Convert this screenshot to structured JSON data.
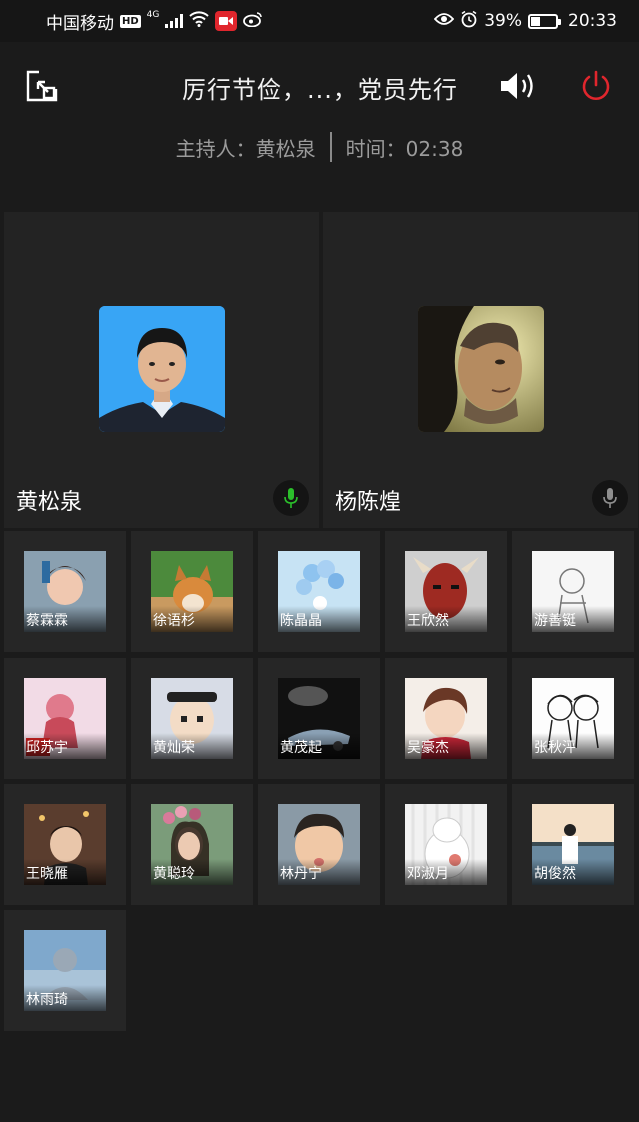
{
  "status_bar": {
    "carrier": "中国移动",
    "hd": "HD",
    "network": "4G",
    "battery_text": "39%",
    "battery_level": 0.39,
    "time": "20:33"
  },
  "header": {
    "title": "厉行节俭，...，党员先行",
    "host_label": "主持人：黄松泉",
    "time_label": "时间：02:38"
  },
  "featured": [
    {
      "name": "黄松泉",
      "mic_color": "#2bbf2b"
    },
    {
      "name": "杨陈煌",
      "mic_color": "#8e8e8e"
    }
  ],
  "participants": [
    "蔡霖霖",
    "徐语杉",
    "陈晶晶",
    "王欣然",
    "游善铤",
    "邱苏宇",
    "黄灿荣",
    "黄茂起",
    "吴豪杰",
    "张秋泙",
    "王晓雁",
    "黄聪玲",
    "林丹宁",
    "邓淑月",
    "胡俊然",
    "林雨琦"
  ],
  "colors": {
    "hangup": "#e0262d",
    "mic_active": "#2bbf2b"
  }
}
